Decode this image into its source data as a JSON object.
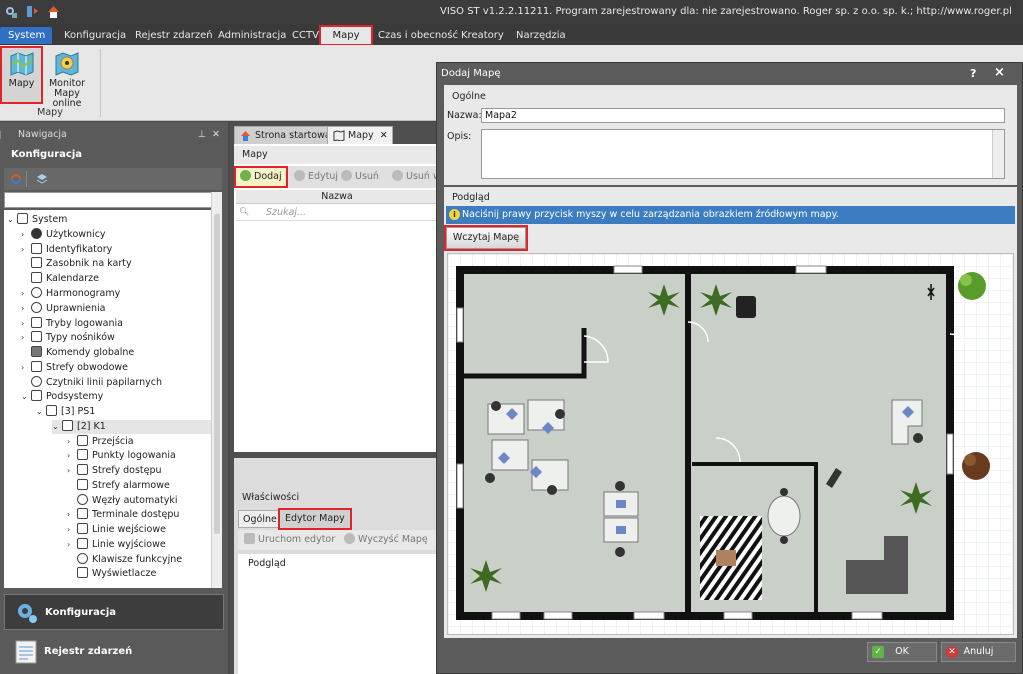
{
  "titlebar": {
    "text": "VISO ST v1.2.2.11211. Program zarejestrowany dla: nie zarejestrowano. Roger sp. z o.o. sp. k.; http://www.roger.pl"
  },
  "menu": {
    "tabs": [
      {
        "label": "System"
      },
      {
        "label": "Konfiguracja"
      },
      {
        "label": "Rejestr zdarzeń"
      },
      {
        "label": "Administracja"
      },
      {
        "label": "CCTV"
      },
      {
        "label": "Mapy"
      },
      {
        "label": "Czas i obecność"
      },
      {
        "label": "Kreatory"
      },
      {
        "label": "Narzędzia"
      }
    ]
  },
  "ribbon": {
    "buttons": [
      {
        "label": "Mapy"
      },
      {
        "label": "Monitor Mapy online"
      }
    ],
    "group_label": "Mapy"
  },
  "nav": {
    "header": "Nawigacja",
    "title": "Konfiguracja",
    "tree": [
      {
        "label": "System"
      },
      {
        "label": "Użytkownicy"
      },
      {
        "label": "Identyfikatory"
      },
      {
        "label": "Zasobnik na karty"
      },
      {
        "label": "Kalendarze"
      },
      {
        "label": "Harmonogramy"
      },
      {
        "label": "Uprawnienia"
      },
      {
        "label": "Tryby logowania"
      },
      {
        "label": "Typy nośników"
      },
      {
        "label": "Komendy globalne"
      },
      {
        "label": "Strefy obwodowe"
      },
      {
        "label": "Czytniki linii papilarnych"
      },
      {
        "label": "Podsystemy"
      },
      {
        "label": "[3] PS1"
      },
      {
        "label": "[2] K1"
      },
      {
        "label": "Przejścia"
      },
      {
        "label": "Punkty logowania"
      },
      {
        "label": "Strefy dostępu"
      },
      {
        "label": "Strefy alarmowe"
      },
      {
        "label": "Węzły automatyki"
      },
      {
        "label": "Terminale dostępu"
      },
      {
        "label": "Linie wejściowe"
      },
      {
        "label": "Linie wyjściowe"
      },
      {
        "label": "Klawisze funkcyjne"
      },
      {
        "label": "Wyświetlacze"
      }
    ],
    "bottom_buttons": [
      {
        "label": "Konfiguracja"
      },
      {
        "label": "Rejestr zdarzeń"
      }
    ]
  },
  "center": {
    "tabs": [
      {
        "label": "Strona startowa"
      },
      {
        "label": "Mapy"
      }
    ],
    "maps_panel_title": "Mapy",
    "toolbar": [
      {
        "label": "Dodaj"
      },
      {
        "label": "Edytuj"
      },
      {
        "label": "Usuń"
      },
      {
        "label": "Usuń w"
      }
    ],
    "grid_header": "Nazwa",
    "search_placeholder": "Szukaj...",
    "properties_title": "Właściwości",
    "properties_tabs": [
      {
        "label": "Ogólne"
      },
      {
        "label": "Edytor Mapy"
      }
    ],
    "properties_toolbar": [
      {
        "label": "Uruchom edytor"
      },
      {
        "label": "Wyczyść Mapę"
      }
    ],
    "preview_title": "Podgląd"
  },
  "dialog": {
    "title": "Dodaj Mapę",
    "help": "?",
    "close": "×",
    "general_heading": "Ogólne",
    "name_label": "Nazwa:",
    "name_value": "Mapa2",
    "desc_label": "Opis:",
    "desc_value": "",
    "preview_heading": "Podgląd",
    "info_text": "Naciśnij prawy przycisk myszy w celu zarządzania obrazkiem źródłowym mapy.",
    "load_button": "Wczytaj Mapę",
    "ok_button": "OK",
    "cancel_button": "Anuluj"
  },
  "colors": {
    "highlight": "#e0242a",
    "system_tab": "#2f6fc4",
    "info_bar": "#3b7dc0",
    "floor": "#c9d0c8",
    "wall": "#111111"
  }
}
